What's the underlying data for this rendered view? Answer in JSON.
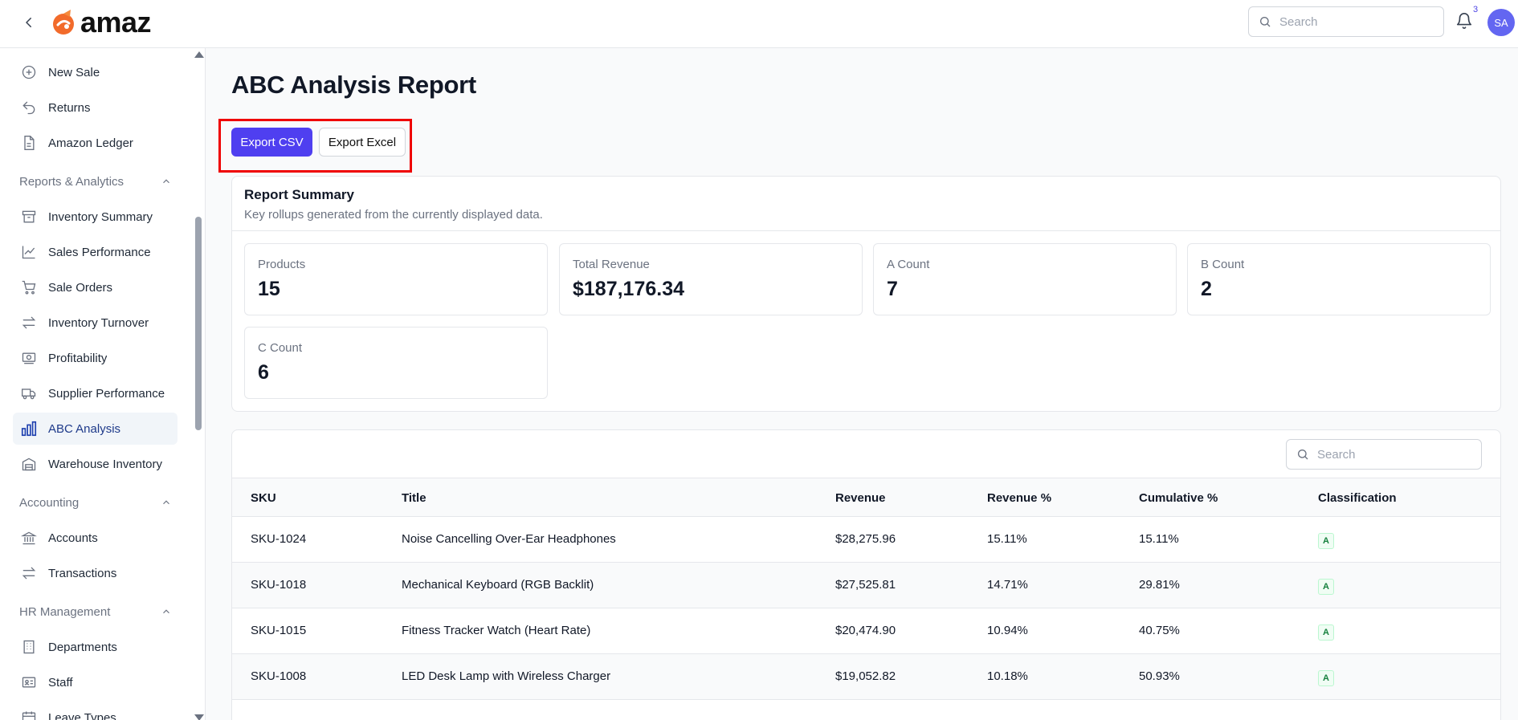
{
  "app": {
    "logo_text": "amaz",
    "brand_color": "#f26b2b"
  },
  "header": {
    "search": {
      "placeholder": "Search"
    },
    "notifications": {
      "count": "3"
    },
    "user": {
      "initials": "SA"
    }
  },
  "sidebar": {
    "items_top": [
      {
        "label": "New Sale",
        "icon": "plus-circle-icon"
      },
      {
        "label": "Returns",
        "icon": "undo-icon"
      },
      {
        "label": "Amazon Ledger",
        "icon": "document-icon"
      }
    ],
    "sections": {
      "reports": "Reports & Analytics",
      "accounting": "Accounting",
      "hr": "HR Management"
    },
    "reports_items": [
      {
        "label": "Inventory Summary",
        "icon": "archive-icon"
      },
      {
        "label": "Sales Performance",
        "icon": "trend-chart-icon"
      },
      {
        "label": "Sale Orders",
        "icon": "cart-icon"
      },
      {
        "label": "Inventory Turnover",
        "icon": "swap-arrows-icon"
      },
      {
        "label": "Profitability",
        "icon": "banknote-icon"
      },
      {
        "label": "Supplier Performance",
        "icon": "truck-icon"
      },
      {
        "label": "ABC Analysis",
        "icon": "bar-chart-icon"
      },
      {
        "label": "Warehouse Inventory",
        "icon": "warehouse-icon"
      }
    ],
    "accounting_items": [
      {
        "label": "Accounts",
        "icon": "bank-icon"
      },
      {
        "label": "Transactions",
        "icon": "swap-arrows-icon"
      }
    ],
    "hr_items": [
      {
        "label": "Departments",
        "icon": "building-icon"
      },
      {
        "label": "Staff",
        "icon": "id-card-icon"
      },
      {
        "label": "Leave Types",
        "icon": "calendar-icon"
      }
    ],
    "active_item": "ABC Analysis"
  },
  "page": {
    "title": "ABC Analysis Report",
    "export_csv": "Export CSV",
    "export_excel": "Export Excel"
  },
  "summary": {
    "title": "Report Summary",
    "subtitle": "Key rollups generated from the currently displayed data.",
    "stats": [
      {
        "label": "Products",
        "value": "15"
      },
      {
        "label": "Total Revenue",
        "value": "$187,176.34"
      },
      {
        "label": "A Count",
        "value": "7"
      },
      {
        "label": "B Count",
        "value": "2"
      },
      {
        "label": "C Count",
        "value": "6"
      }
    ]
  },
  "table": {
    "search_placeholder": "Search",
    "columns": [
      "SKU",
      "Title",
      "Revenue",
      "Revenue %",
      "Cumulative %",
      "Classification"
    ],
    "rows": [
      {
        "sku": "SKU-1024",
        "title": "Noise Cancelling Over-Ear Headphones",
        "revenue": "$28,275.96",
        "revenue_pct": "15.11%",
        "cumulative_pct": "15.11%",
        "classification": "A"
      },
      {
        "sku": "SKU-1018",
        "title": "Mechanical Keyboard (RGB Backlit)",
        "revenue": "$27,525.81",
        "revenue_pct": "14.71%",
        "cumulative_pct": "29.81%",
        "classification": "A"
      },
      {
        "sku": "SKU-1015",
        "title": "Fitness Tracker Watch (Heart Rate)",
        "revenue": "$20,474.90",
        "revenue_pct": "10.94%",
        "cumulative_pct": "40.75%",
        "classification": "A"
      },
      {
        "sku": "SKU-1008",
        "title": "LED Desk Lamp with Wireless Charger",
        "revenue": "$19,052.82",
        "revenue_pct": "10.18%",
        "cumulative_pct": "50.93%",
        "classification": "A"
      }
    ],
    "badge_color": "#15803d"
  }
}
